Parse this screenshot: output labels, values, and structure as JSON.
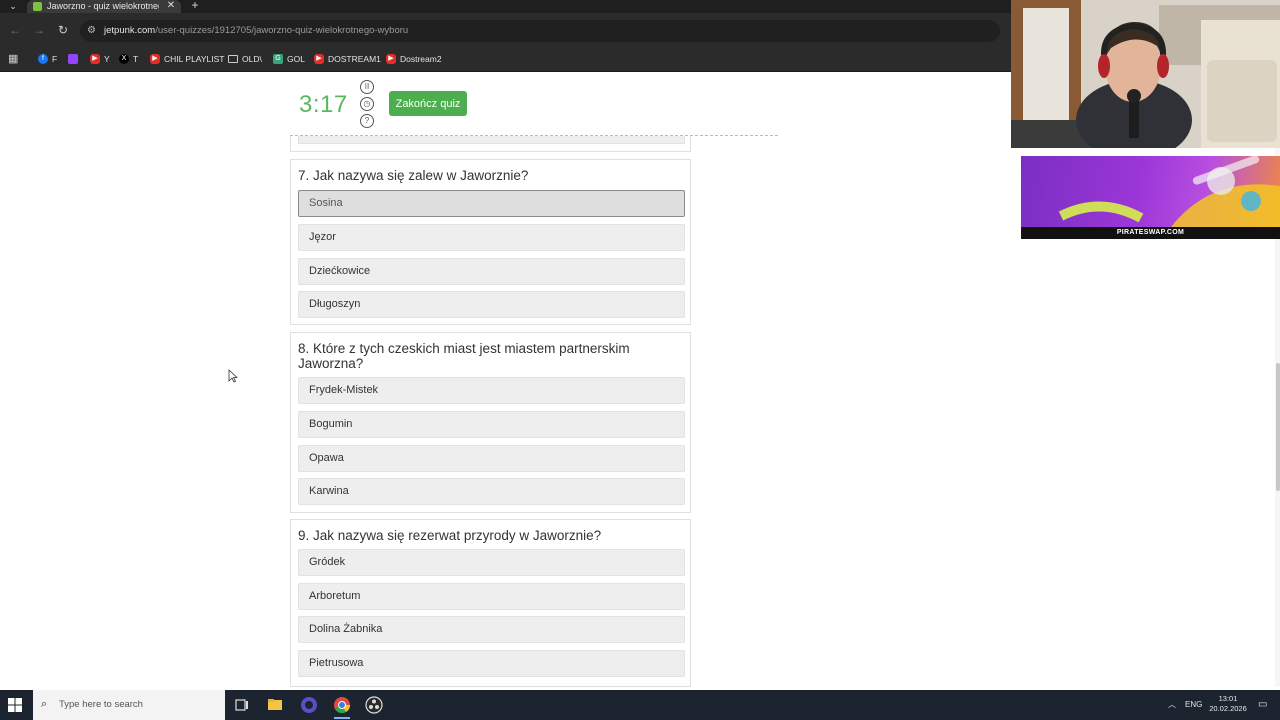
{
  "browser": {
    "tab_title": "Jaworzno - quiz wielokrotnego wyboru",
    "url_host": "jetpunk.com",
    "url_path": "/user-quizzes/1912705/jaworzno-quiz-wielokrotnego-wyboru",
    "bookmarks": [
      "F",
      "Y",
      "T",
      "CHIL PLAYLIST",
      "OLD\\",
      "GOL",
      "DOSTREAM1",
      "Dostream2"
    ]
  },
  "quiz": {
    "timer": "3:17",
    "finish_label": "Zakończ quiz",
    "questions": [
      {
        "title": "7. Jak nazywa się zalew w Jaworznie?",
        "options": [
          "Sosina",
          "Jęzor",
          "Dziećkowice",
          "Długoszyn"
        ],
        "selected_index": 0
      },
      {
        "title": "8. Które z tych czeskich miast jest miastem partnerskim Jaworzna?",
        "options": [
          "Frydek-Mistek",
          "Bogumin",
          "Opawa",
          "Karwina"
        ]
      },
      {
        "title": "9. Jak nazywa się rezerwat przyrody w Jaworznie?",
        "options": [
          "Gródek",
          "Arboretum",
          "Dolina Żabnika",
          "Pietrusowa"
        ]
      }
    ]
  },
  "overlay": {
    "promo_text": "PIRATESWAP.COM"
  },
  "taskbar": {
    "search_placeholder": "Type here to search",
    "language": "ENG",
    "time": "13:01",
    "date": "20.02.2026"
  },
  "colors": {
    "timer": "#5cb85c",
    "finish_button": "#4cae4c",
    "option_bg": "#eeeeee",
    "selected_border": "#8a8a8a"
  }
}
